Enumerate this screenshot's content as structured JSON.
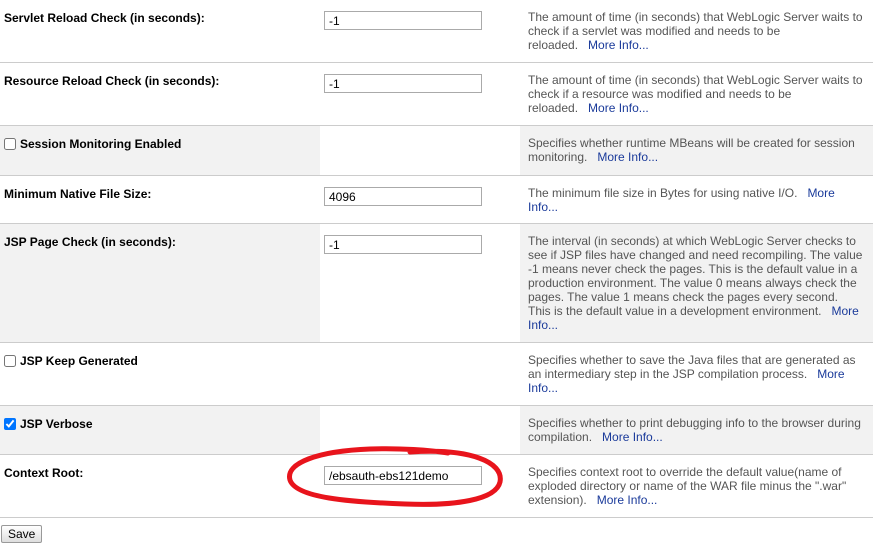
{
  "more_info": "More Info...",
  "rows": [
    {
      "label": "Servlet Reload Check (in seconds):",
      "value": "-1",
      "description": "The amount of time (in seconds) that WebLogic Server waits to check if a servlet was modified and needs to be reloaded."
    },
    {
      "label": "Resource Reload Check (in seconds):",
      "value": "-1",
      "description": "The amount of time (in seconds) that WebLogic Server waits to check if a resource was modified and needs to be reloaded."
    },
    {
      "label": "Session Monitoring Enabled",
      "checked": false,
      "description": "Specifies whether runtime MBeans will be created for session monitoring."
    },
    {
      "label": "Minimum Native File Size:",
      "value": "4096",
      "description": "The minimum file size in Bytes for using native I/O."
    },
    {
      "label": "JSP Page Check (in seconds):",
      "value": "-1",
      "description": "The interval (in seconds) at which WebLogic Server checks to see if JSP files have changed and need recompiling. The value -1 means never check the pages. This is the default value in a production environment. The value 0 means always check the pages. The value 1 means check the pages every second. This is the default value in a development environment."
    },
    {
      "label": "JSP Keep Generated",
      "checked": false,
      "description": "Specifies whether to save the Java files that are generated as an intermediary step in the JSP compilation process."
    },
    {
      "label": "JSP Verbose",
      "checked": true,
      "description": "Specifies whether to print debugging info to the browser during compilation."
    },
    {
      "label": "Context Root:",
      "value": "/ebsauth-ebs121demo",
      "description": "Specifies context root to override the default value(name of exploded directory or name of the WAR file minus the \".war\" extension)."
    }
  ],
  "save_label": "Save",
  "annotation_color": "#e8141c"
}
